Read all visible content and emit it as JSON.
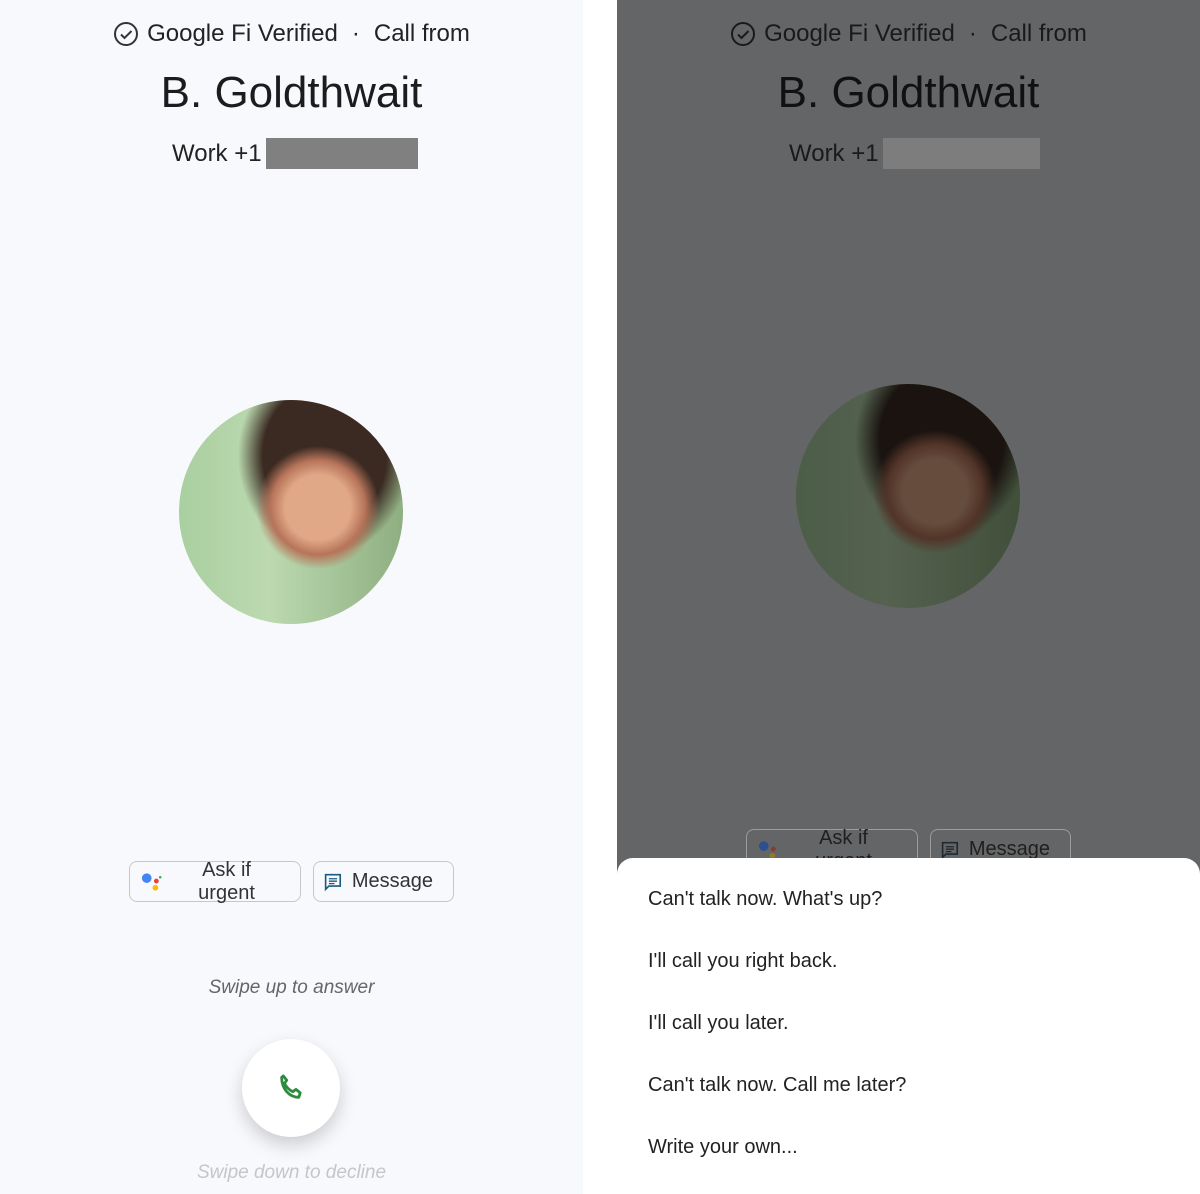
{
  "caller": {
    "verified": "Google Fi Verified",
    "separator": "·",
    "call_from": "Call from",
    "name": "B. Goldthwait",
    "number_label": "Work +1"
  },
  "actions": {
    "ask_if_urgent": "Ask if urgent",
    "message": "Message"
  },
  "hints": {
    "answer": "Swipe up to answer",
    "decline": "Swipe down to decline"
  },
  "quick_replies": [
    "Can't talk now. What's up?",
    "I'll call you right back.",
    "I'll call you later.",
    "Can't talk now. Call me later?",
    "Write your own..."
  ],
  "colors": {
    "answer_green": "#2e8b3e",
    "assistant_blue": "#4285f4",
    "assistant_red": "#ea4335",
    "assistant_yellow": "#fbbc05",
    "assistant_green": "#34a853",
    "message_icon": "#1a5a80"
  }
}
